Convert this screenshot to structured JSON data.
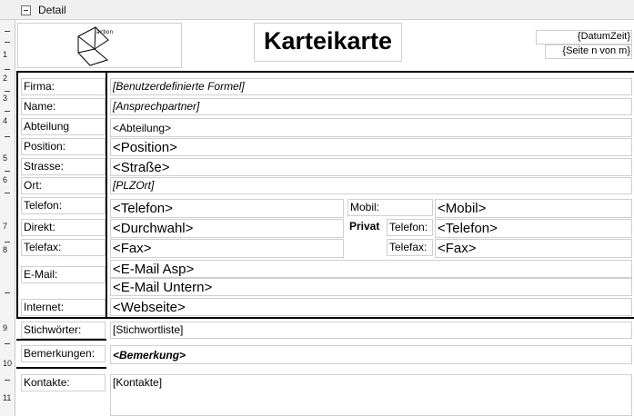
{
  "section": {
    "label": "Detail"
  },
  "ruler": {
    "numbers": [
      "1",
      "2",
      "3",
      "4",
      "5",
      "6",
      "7",
      "8",
      "9",
      "10",
      "11"
    ]
  },
  "logo": {
    "text": "arbon"
  },
  "report": {
    "title": "Karteikarte",
    "datetime": "{DatumZeit}",
    "page": "{Seite n von m}"
  },
  "labels": {
    "firma": "Firma:",
    "name": "Name:",
    "abteilung": "Abteilung",
    "position": "Position:",
    "strasse": "Strasse:",
    "ort": "Ort:",
    "telefon": "Telefon:",
    "direkt": "Direkt:",
    "telefax": "Telefax:",
    "email": "E-Mail:",
    "internet": "Internet:",
    "mobil": "Mobil:",
    "privat": "Privat",
    "privat_telefon": "Telefon:",
    "privat_telefax": "Telefax:",
    "stichwoerter": "Stichwörter:",
    "bemerkungen": "Bemerkungen:",
    "kontakte": "Kontakte:"
  },
  "fields": {
    "firma": "[Benutzerdefinierte Formel]",
    "name": "[Ansprechpartner]",
    "abteilung": "<Abteilung>",
    "position": "<Position>",
    "strasse": "<Straße>",
    "ort": "[PLZOrt]",
    "telefon": "<Telefon>",
    "durchwahl": "<Durchwahl>",
    "fax": "<Fax>",
    "email_asp": "<E-Mail Asp>",
    "email_untern": "<E-Mail Untern>",
    "webseite": "<Webseite>",
    "mobil": "<Mobil>",
    "privat_telefon": "<Telefon>",
    "privat_fax": "<Fax>",
    "stichwortliste": "[Stichwortliste]",
    "bemerkung": "<Bemerkung>",
    "kontakte": "[Kontakte]"
  }
}
